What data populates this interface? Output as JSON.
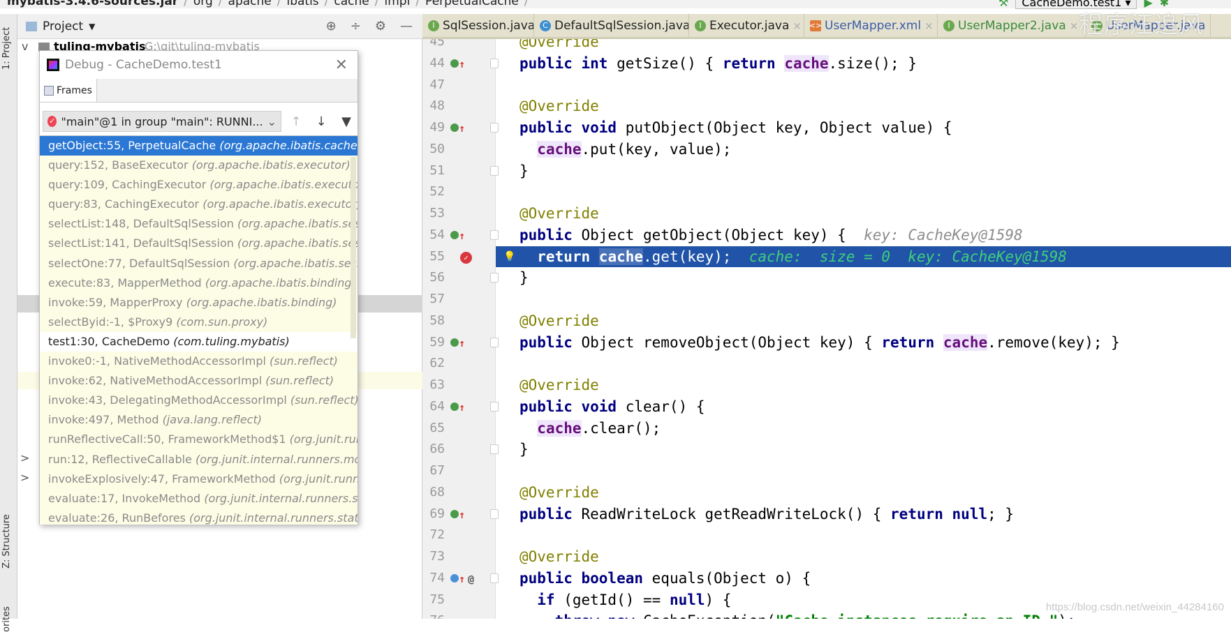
{
  "breadcrumb": [
    "mybatis-3.4.6-sources.jar",
    "org",
    "apache",
    "ibatis",
    "cache",
    "impl",
    "PerpetualCache"
  ],
  "run_config": "CacheDemo.test1",
  "watermark": "程序汪追风",
  "csdn_watermark": "https://blog.csdn.net/weixin_44284160",
  "left_strip": {
    "project": "1: Project",
    "structure": "Z: Structure",
    "favorites": "orites"
  },
  "project_panel": {
    "title": "Project",
    "root": "tuling-mybatis",
    "root_path": "G:\\git\\tuling-mybatis"
  },
  "tabs": [
    {
      "label": "SqlSession.java",
      "icon": "interface-icon",
      "color": "#6aa84f",
      "text": "#222"
    },
    {
      "label": "DefaultSqlSession.java",
      "icon": "class-icon",
      "color": "#3d8fd1",
      "text": "#222"
    },
    {
      "label": "Executor.java",
      "icon": "interface-icon",
      "color": "#6aa84f",
      "text": "#222"
    },
    {
      "label": "UserMapper.xml",
      "icon": "xml-icon",
      "color": "#e07b39",
      "text": "#3d5aa8"
    },
    {
      "label": "UserMapper2.java",
      "icon": "interface-icon",
      "color": "#6aa84f",
      "text": "#3a8a3a"
    },
    {
      "label": "UserMapper.java",
      "icon": "interface-icon",
      "color": "#6aa84f",
      "text": "#3d5aa8"
    }
  ],
  "debug_popup": {
    "title": "Debug - CacheDemo.test1",
    "tab": "Frames",
    "thread": "\"main\"@1 in group \"main\": RUNNI...",
    "frames": [
      {
        "method": "getObject:55, PerpetualCache",
        "pkg": "(org.apache.ibatis.cache.impl)"
      },
      {
        "method": "query:152, BaseExecutor",
        "pkg": "(org.apache.ibatis.executor)"
      },
      {
        "method": "query:109, CachingExecutor",
        "pkg": "(org.apache.ibatis.executor)"
      },
      {
        "method": "query:83, CachingExecutor",
        "pkg": "(org.apache.ibatis.executor)"
      },
      {
        "method": "selectList:148, DefaultSqlSession",
        "pkg": "(org.apache.ibatis.session)"
      },
      {
        "method": "selectList:141, DefaultSqlSession",
        "pkg": "(org.apache.ibatis.session)"
      },
      {
        "method": "selectOne:77, DefaultSqlSession",
        "pkg": "(org.apache.ibatis.session)"
      },
      {
        "method": "execute:83, MapperMethod",
        "pkg": "(org.apache.ibatis.binding)"
      },
      {
        "method": "invoke:59, MapperProxy",
        "pkg": "(org.apache.ibatis.binding)"
      },
      {
        "method": "selectByid:-1, $Proxy9",
        "pkg": "(com.sun.proxy)"
      },
      {
        "method": "test1:30, CacheDemo",
        "pkg": "(com.tuling.mybatis)"
      },
      {
        "method": "invoke0:-1, NativeMethodAccessorImpl",
        "pkg": "(sun.reflect)"
      },
      {
        "method": "invoke:62, NativeMethodAccessorImpl",
        "pkg": "(sun.reflect)"
      },
      {
        "method": "invoke:43, DelegatingMethodAccessorImpl",
        "pkg": "(sun.reflect)"
      },
      {
        "method": "invoke:497, Method",
        "pkg": "(java.lang.reflect)"
      },
      {
        "method": "runReflectiveCall:50, FrameworkMethod$1",
        "pkg": "(org.junit.runners.model)"
      },
      {
        "method": "run:12, ReflectiveCallable",
        "pkg": "(org.junit.internal.runners.model)"
      },
      {
        "method": "invokeExplosively:47, FrameworkMethod",
        "pkg": "(org.junit.runners.model)"
      },
      {
        "method": "evaluate:17, InvokeMethod",
        "pkg": "(org.junit.internal.runners.statements)"
      },
      {
        "method": "evaluate:26, RunBefores",
        "pkg": "(org.junit.internal.runners.statements)"
      }
    ]
  },
  "code": [
    {
      "n": "45",
      "seg": [
        [
          "@Override",
          "a"
        ]
      ]
    },
    {
      "n": "44",
      "g": "override",
      "fold": true,
      "seg": [
        [
          "public int ",
          "k"
        ],
        [
          "getSize() { ",
          "p"
        ],
        [
          "return ",
          "k"
        ],
        [
          "cache",
          "f"
        ],
        [
          ".size(); }",
          "p"
        ]
      ]
    },
    {
      "n": "47",
      "seg": []
    },
    {
      "n": "48",
      "seg": [
        [
          "@Override",
          "a"
        ]
      ]
    },
    {
      "n": "49",
      "g": "override",
      "fold": true,
      "seg": [
        [
          "public void ",
          "k"
        ],
        [
          "putObject(Object key, Object value) {",
          "p"
        ]
      ]
    },
    {
      "n": "50",
      "seg": [
        [
          "  ",
          "p"
        ],
        [
          "cache",
          "f"
        ],
        [
          ".put(key, value);",
          "p"
        ]
      ]
    },
    {
      "n": "51",
      "fold": true,
      "seg": [
        [
          "}",
          "p"
        ]
      ]
    },
    {
      "n": "52",
      "seg": []
    },
    {
      "n": "53",
      "seg": [
        [
          "@Override",
          "a"
        ]
      ]
    },
    {
      "n": "54",
      "g": "override",
      "fold": true,
      "seg": [
        [
          "public ",
          "k"
        ],
        [
          "Object getObject(Object key) {  ",
          "p"
        ],
        [
          "key: CacheKey@1598",
          "h"
        ]
      ]
    },
    {
      "n": "55",
      "g": "breakpoint",
      "exec": true,
      "seg": [
        [
          "  return ",
          "k"
        ],
        [
          "cache",
          "f"
        ],
        [
          ".get(key);  ",
          "p"
        ],
        [
          "cache:  size = 0  key: CacheKey@1598",
          "h"
        ]
      ]
    },
    {
      "n": "56",
      "fold": true,
      "seg": [
        [
          "}",
          "p"
        ]
      ]
    },
    {
      "n": "57",
      "seg": []
    },
    {
      "n": "58",
      "seg": [
        [
          "@Override",
          "a"
        ]
      ]
    },
    {
      "n": "59",
      "g": "override",
      "fold": true,
      "seg": [
        [
          "public ",
          "k"
        ],
        [
          "Object removeObject(Object key) { ",
          "p"
        ],
        [
          "return ",
          "k"
        ],
        [
          "cache",
          "f"
        ],
        [
          ".remove(key); }",
          "p"
        ]
      ]
    },
    {
      "n": "62",
      "seg": []
    },
    {
      "n": "63",
      "seg": [
        [
          "@Override",
          "a"
        ]
      ]
    },
    {
      "n": "64",
      "g": "override",
      "fold": true,
      "seg": [
        [
          "public void ",
          "k"
        ],
        [
          "clear() {",
          "p"
        ]
      ]
    },
    {
      "n": "65",
      "seg": [
        [
          "  ",
          "p"
        ],
        [
          "cache",
          "f"
        ],
        [
          ".clear();",
          "p"
        ]
      ]
    },
    {
      "n": "66",
      "fold": true,
      "seg": [
        [
          "}",
          "p"
        ]
      ]
    },
    {
      "n": "67",
      "seg": []
    },
    {
      "n": "68",
      "seg": [
        [
          "@Override",
          "a"
        ]
      ]
    },
    {
      "n": "69",
      "g": "override",
      "fold": true,
      "seg": [
        [
          "public ",
          "k"
        ],
        [
          "ReadWriteLock getReadWriteLock() { ",
          "p"
        ],
        [
          "return null",
          "k"
        ],
        [
          "; }",
          "p"
        ]
      ]
    },
    {
      "n": "72",
      "seg": []
    },
    {
      "n": "73",
      "seg": [
        [
          "@Override",
          "a"
        ]
      ]
    },
    {
      "n": "74",
      "g": "override-at",
      "fold": true,
      "seg": [
        [
          "public boolean ",
          "k"
        ],
        [
          "equals(Object o) {",
          "p"
        ]
      ]
    },
    {
      "n": "75",
      "seg": [
        [
          "  if ",
          "k"
        ],
        [
          "(getId() == ",
          "p"
        ],
        [
          "null",
          "k"
        ],
        [
          ") {",
          "p"
        ]
      ]
    },
    {
      "n": "76",
      "seg": [
        [
          "    throw new ",
          "k"
        ],
        [
          "CacheException(",
          "p"
        ],
        [
          "\"Cache instances require an ID.\"",
          "s"
        ],
        [
          ");",
          "p"
        ]
      ]
    }
  ],
  "colors": {
    "exec_line": "#2154a8",
    "selected_frame": "#2a77d4",
    "frames_bg": "#fdfde6",
    "tabs_bg": "#e4e2cf"
  }
}
